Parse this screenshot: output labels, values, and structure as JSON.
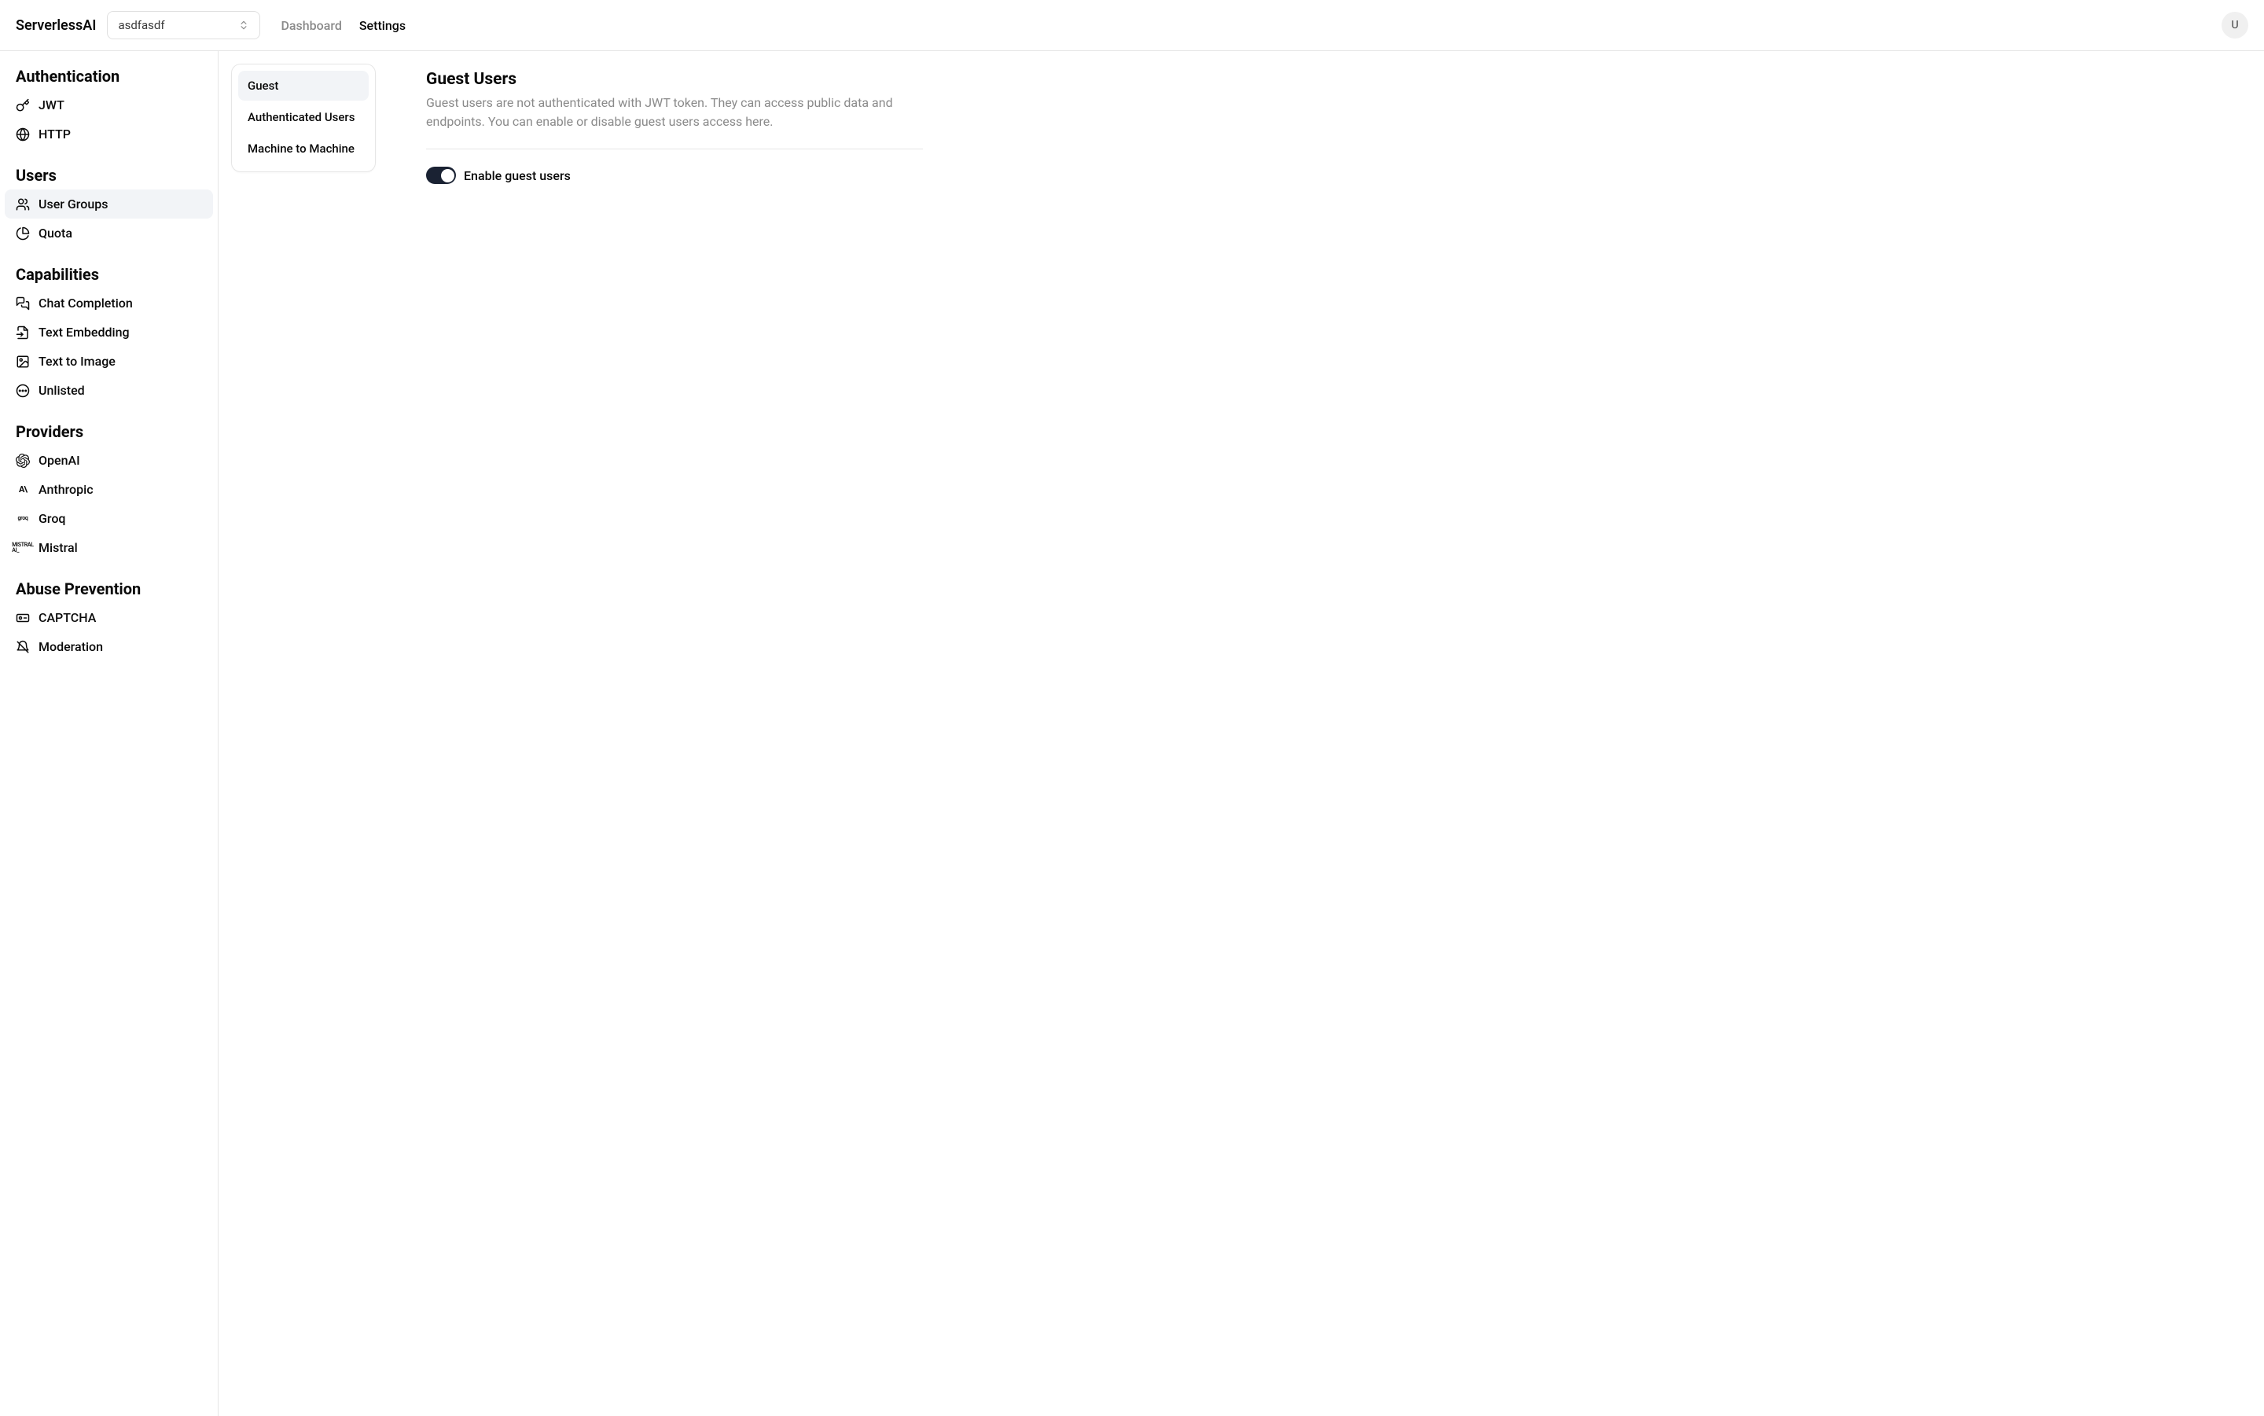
{
  "header": {
    "logo": "ServerlessAI",
    "project_selected": "asdfasdf",
    "nav": {
      "dashboard": "Dashboard",
      "settings": "Settings"
    },
    "avatar_initial": "U"
  },
  "sidebar": {
    "sections": [
      {
        "heading": "Authentication",
        "items": [
          {
            "label": "JWT",
            "icon": "key-icon"
          },
          {
            "label": "HTTP",
            "icon": "globe-icon"
          }
        ]
      },
      {
        "heading": "Users",
        "items": [
          {
            "label": "User Groups",
            "icon": "users-icon",
            "active": true
          },
          {
            "label": "Quota",
            "icon": "pie-icon"
          }
        ]
      },
      {
        "heading": "Capabilities",
        "items": [
          {
            "label": "Chat Completion",
            "icon": "chat-icon"
          },
          {
            "label": "Text Embedding",
            "icon": "embed-icon"
          },
          {
            "label": "Text to Image",
            "icon": "image-icon"
          },
          {
            "label": "Unlisted",
            "icon": "dots-icon"
          }
        ]
      },
      {
        "heading": "Providers",
        "items": [
          {
            "label": "OpenAI",
            "icon": "openai-icon"
          },
          {
            "label": "Anthropic",
            "icon": "anthropic-icon"
          },
          {
            "label": "Groq",
            "icon": "groq-icon"
          },
          {
            "label": "Mistral",
            "icon": "mistral-icon"
          }
        ]
      },
      {
        "heading": "Abuse Prevention",
        "items": [
          {
            "label": "CAPTCHA",
            "icon": "captcha-icon"
          },
          {
            "label": "Moderation",
            "icon": "moderation-icon"
          }
        ]
      }
    ]
  },
  "sub_sidebar": {
    "items": [
      {
        "label": "Guest",
        "active": true
      },
      {
        "label": "Authenticated Users"
      },
      {
        "label": "Machine to Machine"
      }
    ]
  },
  "main": {
    "title": "Guest Users",
    "description": "Guest users are not authenticated with JWT token. They can access public data and endpoints. You can enable or disable guest users access here.",
    "toggle_label": "Enable guest users",
    "toggle_on": true
  }
}
